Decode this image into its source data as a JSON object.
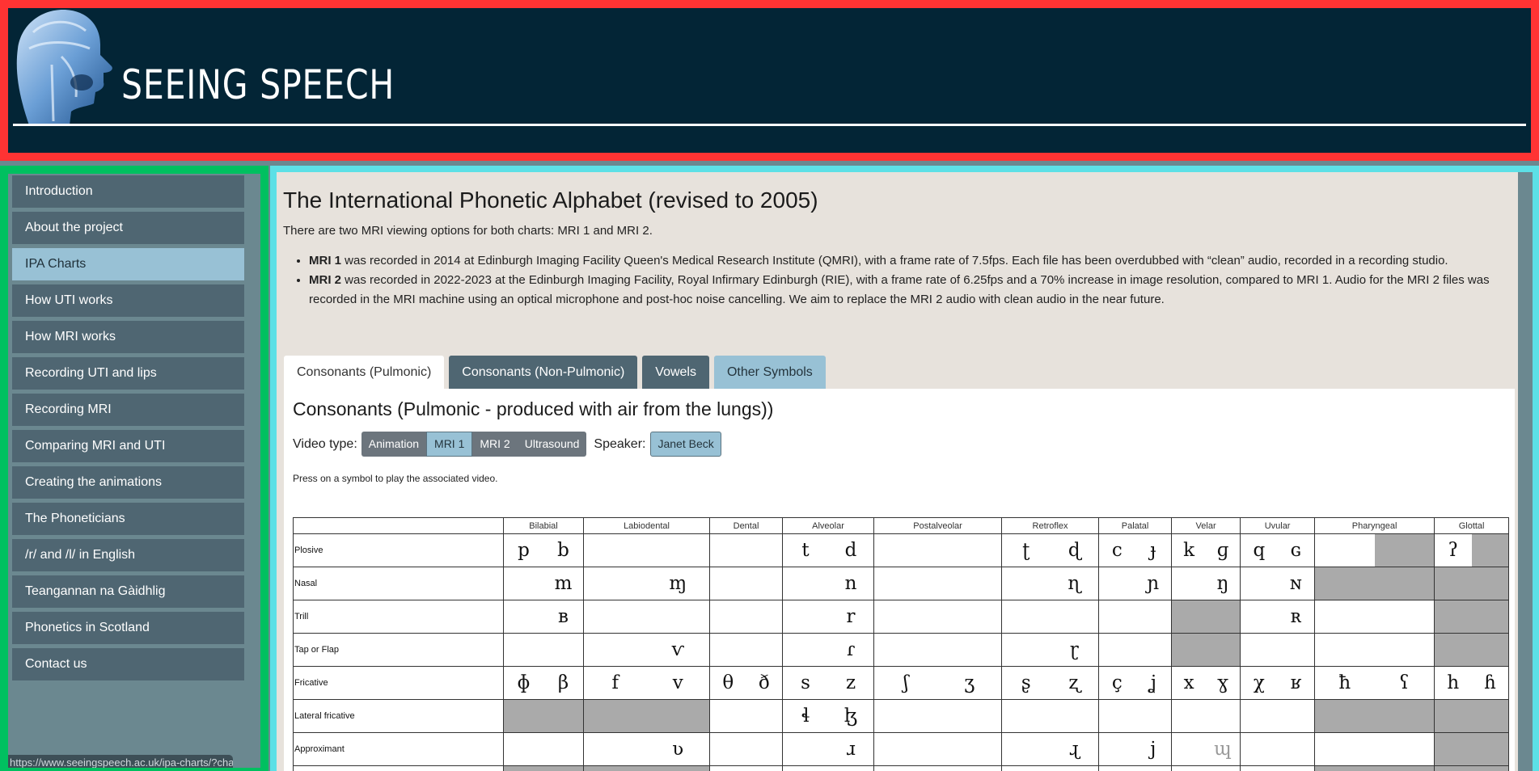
{
  "header": {
    "title": "SEEING SPEECH"
  },
  "sidebar": {
    "items": [
      {
        "label": "Introduction"
      },
      {
        "label": "About the project"
      },
      {
        "label": "IPA Charts",
        "active": true
      },
      {
        "label": "How UTI works"
      },
      {
        "label": "How MRI works"
      },
      {
        "label": "Recording UTI and lips"
      },
      {
        "label": "Recording MRI"
      },
      {
        "label": "Comparing MRI and UTI"
      },
      {
        "label": "Creating the animations"
      },
      {
        "label": "The Phoneticians"
      },
      {
        "label": "/r/ and /l/ in English"
      },
      {
        "label": "Teangannan na Gàidhlig"
      },
      {
        "label": "Phonetics in Scotland"
      },
      {
        "label": "Contact us"
      }
    ]
  },
  "status_url": "https://www.seeingspeech.ac.uk/ipa-charts/?chart=2",
  "page": {
    "title": "The International Phonetic Alphabet (revised to 2005)",
    "intro": "There are two MRI viewing options for both charts: MRI 1 and MRI 2.",
    "bullets": [
      {
        "bold": "MRI 1",
        "text": " was recorded in 2014 at Edinburgh Imaging Facility Queen's Medical Research Institute (QMRI), with a frame rate of 7.5fps. Each file has been overdubbed with “clean” audio, recorded in a recording studio."
      },
      {
        "bold": "MRI 2",
        "text": " was recorded in 2022-2023 at the Edinburgh Imaging Facility, Royal Infirmary Edinburgh (RIE), with a frame rate of 6.25fps and a 70% increase in image resolution, compared to MRI 1. Audio for the MRI 2 files was recorded in the MRI machine using an optical microphone and post-hoc noise cancelling. We aim to replace the MRI 2 audio with clean audio in the near future."
      }
    ],
    "tabs": [
      "Consonants (Pulmonic)",
      "Consonants (Non-Pulmonic)",
      "Vowels",
      "Other Symbols"
    ],
    "section_title": "Consonants (Pulmonic - produced with air from the lungs))",
    "video_type_label": "Video type:",
    "video_types": [
      "Animation",
      "MRI 1",
      "MRI 2",
      "Ultrasound"
    ],
    "video_type_selected": "MRI 1",
    "speaker_label": "Speaker:",
    "speaker": "Janet Beck",
    "press_note": "Press on a symbol to play the associated video."
  },
  "colors": {
    "header_bg": "#032536",
    "nav_bg": "#4f6672",
    "nav_active": "#98c1d5",
    "content_bg": "#e7e2dc",
    "na_cell": "#aaaaaa"
  },
  "ipa_table": {
    "columns": [
      "Bilabial",
      "Labiodental",
      "Dental",
      "Alveolar",
      "Postalveolar",
      "Retroflex",
      "Palatal",
      "Velar",
      "Uvular",
      "Pharyngeal",
      "Glottal"
    ],
    "note": "cells: '' = empty, '#' = impossible (grey)",
    "rows": [
      {
        "label": "Plosive",
        "cells": [
          "p",
          "b",
          "",
          "",
          "",
          "",
          "t",
          "d",
          "",
          "",
          "ʈ",
          "ɖ",
          "c",
          "ɟ",
          "k",
          "ɡ",
          "q",
          "ɢ",
          "",
          "#",
          "ʔ",
          "#"
        ]
      },
      {
        "label": "Nasal",
        "cells": [
          "",
          "m",
          "",
          "ɱ",
          "",
          "",
          "",
          "n",
          "",
          "",
          "",
          "ɳ",
          "",
          "ɲ",
          "",
          "ŋ",
          "",
          "ɴ",
          "#",
          "#",
          "#",
          "#"
        ]
      },
      {
        "label": "Trill",
        "cells": [
          "",
          "ʙ",
          "",
          "",
          "",
          "",
          "",
          "r",
          "",
          "",
          "",
          "",
          "",
          "",
          "#",
          "#",
          "",
          "ʀ",
          "",
          "",
          "#",
          "#"
        ]
      },
      {
        "label": "Tap or Flap",
        "cells": [
          "",
          "",
          "",
          "ⱱ",
          "",
          "",
          "",
          "ɾ",
          "",
          "",
          "",
          "ɽ",
          "",
          "",
          "#",
          "#",
          "",
          "",
          "",
          "",
          "#",
          "#"
        ]
      },
      {
        "label": "Fricative",
        "cells": [
          "ɸ",
          "β",
          "f",
          "v",
          "θ",
          "ð",
          "s",
          "z",
          "ʃ",
          "ʒ",
          "ʂ",
          "ʐ",
          "ç",
          "ʝ",
          "x",
          "ɣ",
          "χ",
          "ʁ",
          "ħ",
          "ʕ",
          "h",
          "ɦ"
        ]
      },
      {
        "label": "Lateral fricative",
        "cells": [
          "#",
          "#",
          "#",
          "#",
          "",
          "",
          "ɬ",
          "ɮ",
          "",
          "",
          "",
          "",
          "",
          "",
          "",
          "",
          "",
          "",
          "#",
          "#",
          "#",
          "#"
        ]
      },
      {
        "label": "Approximant",
        "cells": [
          "",
          "",
          "",
          "ʋ",
          "",
          "",
          "",
          "ɹ",
          "",
          "",
          "",
          "ɻ",
          "",
          "j",
          "",
          "ɰ",
          "",
          "",
          "",
          "",
          "#",
          "#"
        ],
        "dim": [
          "ɰ"
        ]
      },
      {
        "label": "",
        "cells": [
          "#",
          "#",
          "#",
          "#",
          "",
          "",
          "",
          "",
          "",
          "",
          "",
          "",
          "",
          "",
          "",
          "",
          "",
          "",
          "#",
          "#",
          "#",
          "#"
        ]
      }
    ]
  }
}
